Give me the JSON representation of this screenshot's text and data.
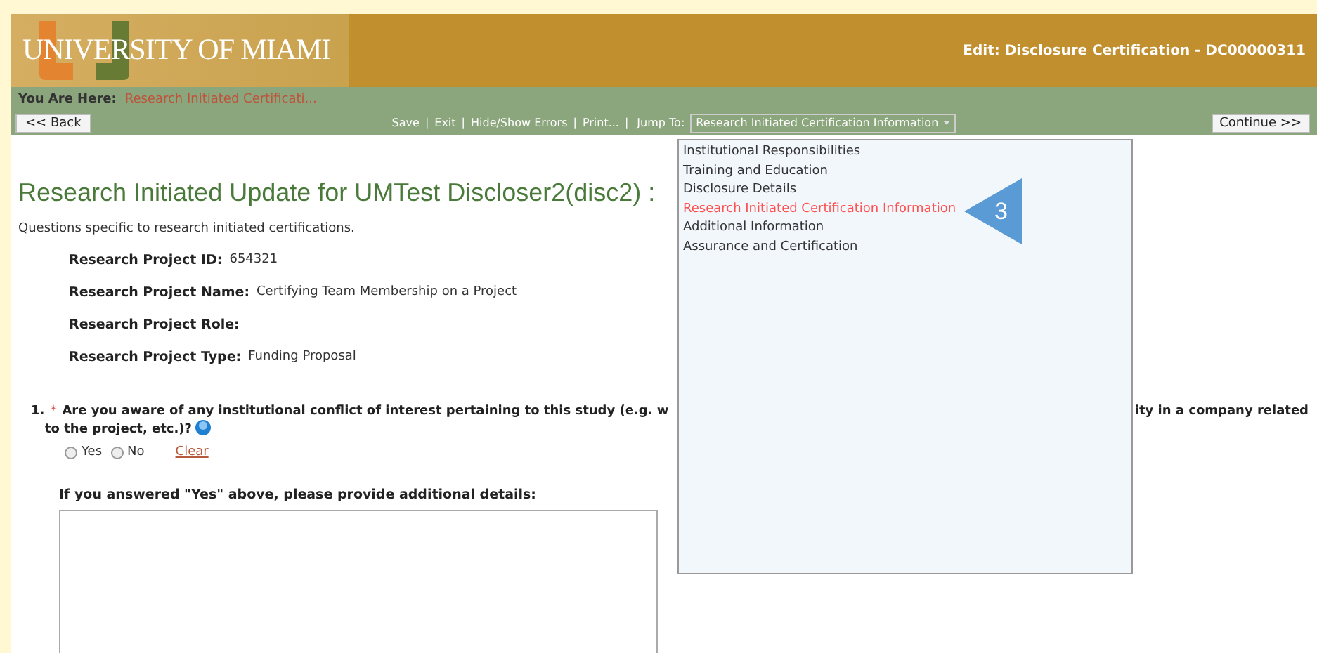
{
  "header": {
    "logo": "UNIVERSITY OF MIAMI",
    "title": "Edit: Disclosure Certification - DC00000311"
  },
  "breadcrumb": {
    "label": "You Are Here:",
    "current": "Research Initiated Certificati..."
  },
  "toolbar": {
    "back": "<< Back",
    "links": [
      "Save",
      "Exit",
      "Hide/Show Errors",
      "Print..."
    ],
    "separator": "|",
    "jump_label": "Jump To:",
    "jump_value": "Research Initiated Certification Information",
    "continue": "Continue >>"
  },
  "jump_menu": [
    {
      "label": "Institutional Responsibilities",
      "selected": false
    },
    {
      "label": "Training and Education",
      "selected": false
    },
    {
      "label": "Disclosure Details",
      "selected": false
    },
    {
      "label": "Research Initiated Certification Information",
      "selected": true
    },
    {
      "label": "Additional Information",
      "selected": false
    },
    {
      "label": "Assurance and Certification",
      "selected": false
    }
  ],
  "callout": "3",
  "page": {
    "heading": "Research Initiated Update for UMTest Discloser2(disc2) :",
    "subtitle": "Questions specific to research initiated certifications.",
    "fields": [
      {
        "label": "Research Project ID:",
        "value": "654321"
      },
      {
        "label": "Research Project Name:",
        "value": "Certifying Team Membership on a Project"
      },
      {
        "label": "Research Project Role:"
      },
      {
        "label": "Research Project Type:",
        "value": "Funding Proposal"
      }
    ],
    "question": {
      "number": "1.",
      "required": "*",
      "text_start": "Are you aware of any institutional conflict of interest pertaining to this study (e.g. w",
      "text_end": "ity in a company related",
      "text_line2": "to the project, etc.)?",
      "options": [
        {
          "label": "Yes",
          "selected": false
        },
        {
          "label": "No",
          "selected": false
        }
      ],
      "clear": "Clear"
    },
    "details_label": "If you answered \"Yes\" above, please provide additional details:"
  }
}
